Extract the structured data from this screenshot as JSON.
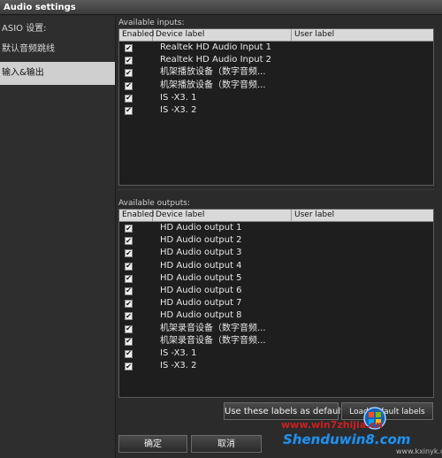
{
  "window": {
    "title": "Audio settings"
  },
  "sidebar": {
    "items": [
      {
        "label": "ASIO 设置:"
      },
      {
        "label": "默认音频跳线"
      },
      {
        "label": "输入&输出"
      }
    ]
  },
  "inputs": {
    "section_label": "Available inputs:",
    "headers": [
      "Enabled",
      "Device label",
      "User label"
    ],
    "rows": [
      {
        "checked": "✔",
        "device": "Realtek HD Audio Input 1"
      },
      {
        "checked": "✔",
        "device": "Realtek HD Audio Input 2"
      },
      {
        "checked": "✔",
        "device": "机架播放设备（数字音频..."
      },
      {
        "checked": "✔",
        "device": "机架播放设备（数字音频..."
      },
      {
        "checked": "✔",
        "device": "IS   -X3. 1"
      },
      {
        "checked": "✔",
        "device": "IS   -X3. 2"
      }
    ]
  },
  "outputs": {
    "section_label": "Available outputs:",
    "headers": [
      "Enabled",
      "Device label",
      "User label"
    ],
    "rows": [
      {
        "checked": "✔",
        "device": "HD Audio output 1"
      },
      {
        "checked": "✔",
        "device": "HD Audio output 2"
      },
      {
        "checked": "✔",
        "device": "HD Audio output 3"
      },
      {
        "checked": "✔",
        "device": "HD Audio output 4"
      },
      {
        "checked": "✔",
        "device": "HD Audio output 5"
      },
      {
        "checked": "✔",
        "device": "HD Audio output 6"
      },
      {
        "checked": "✔",
        "device": "HD Audio output 7"
      },
      {
        "checked": "✔",
        "device": "HD Audio output 8"
      },
      {
        "checked": "✔",
        "device": "机架录音设备（数字音频..."
      },
      {
        "checked": "✔",
        "device": "机架录音设备（数字音频..."
      },
      {
        "checked": "✔",
        "device": "IS   -X3. 1"
      },
      {
        "checked": "✔",
        "device": "IS   -X3. 2"
      }
    ]
  },
  "buttons": {
    "use_default": "Use these labels as default",
    "load_default": "Load default labels",
    "ok": "确定",
    "cancel": "取消"
  },
  "watermark": {
    "top": "www.win7zhijia.cn",
    "main": "Shenduwin8.com",
    "sub": "www.kxinyk.com"
  }
}
